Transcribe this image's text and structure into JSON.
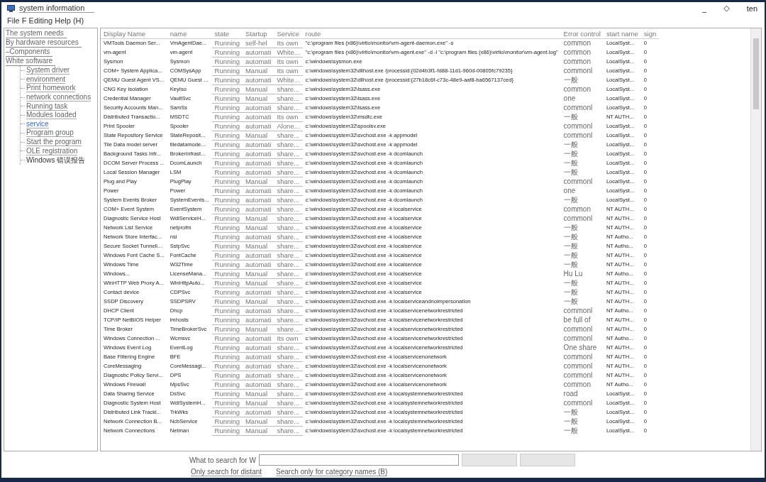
{
  "window": {
    "title": "system information",
    "controls": [
      "_",
      "◇",
      "ten"
    ]
  },
  "menu": "File F Editing Help (H)",
  "sidebar": {
    "items": [
      {
        "label": "The system needs",
        "selected": false
      },
      {
        "label": "By hardware resources",
        "selected": false
      },
      {
        "label": "–Components",
        "selected": false
      },
      {
        "label": "White software",
        "selected": false,
        "expanded": true,
        "children": [
          {
            "label": "System driver",
            "selected": false
          },
          {
            "label": "environment",
            "selected": false
          },
          {
            "label": "Print homework",
            "selected": false
          },
          {
            "label": "network connections",
            "selected": false
          },
          {
            "label": "Running task",
            "selected": false
          },
          {
            "label": "Modules loaded",
            "selected": false
          },
          {
            "label": "service",
            "selected": true
          },
          {
            "label": "Program group",
            "selected": false
          },
          {
            "label": "Start the program",
            "selected": false
          },
          {
            "label": "OLE registration",
            "selected": false
          },
          {
            "label": "Windows 错误报告",
            "selected": false
          }
        ]
      }
    ]
  },
  "table": {
    "columns": [
      "Display Name",
      "name",
      "state",
      "Startup",
      "Service",
      "route",
      "Error control",
      "start name",
      "sign"
    ],
    "rows": [
      {
        "cells": [
          "VMTools Daemon Ser...",
          "VmAgentDae...",
          "Running",
          "self-hel",
          "Its own",
          "\"c:\\program files (x86)\\virtio\\monitor\\vm-agent-daemon.exe\" -s",
          "common",
          "LocalSyst...",
          "0"
        ]
      },
      {
        "cells": [
          "vm-agent",
          "vm-agent",
          "Running",
          "automati",
          "White...",
          "\"c:\\program files (x86)\\virtio\\monitor\\vm-agent.exe\" -d -l \"c:\\program files (x86)\\virtio\\monitor\\vm-agent.log\"",
          "common",
          "LocalSyst...",
          "0"
        ]
      },
      {
        "cells": [
          "Sysmon",
          "Sysmon",
          "Running",
          "automati",
          "Its own",
          "c:\\windows\\sysmon.exe",
          "common",
          "LocalSyst...",
          "0"
        ]
      },
      {
        "cells": [
          "COM+ System Applica...",
          "COMSysApp",
          "Running",
          "Manual",
          "Its own",
          "c:\\windows\\system32\\dllhost.exe /processid:{02d4b3f1-fd88-11d1-960d-00805fc79235}",
          "commonl",
          "LocalSyst...",
          "0"
        ]
      },
      {
        "cells": [
          "QEMU Guest Agent VS...",
          "QEMU Guest ...",
          "Running",
          "automati",
          "White...",
          "c:\\windows\\system32\\dllhost.exe /processid:{27b18c6f-c73c-48e9-aaf8-ba6567137ced}",
          "一般",
          "LocalSyst...",
          "0"
        ]
      },
      {
        "cells": [
          "CNG Key Isolation",
          "KeyIso",
          "Running",
          "Manual",
          "share...",
          "c:\\windows\\system32\\lsass.exe",
          "common",
          "LocalSyst...",
          "0"
        ]
      },
      {
        "cells": [
          "Credential Manager",
          "VaultSvc",
          "Running",
          "Manual",
          "share...",
          "c:\\windows\\system32\\lsass.exe",
          "one",
          "LocalSyst...",
          "0"
        ]
      },
      {
        "cells": [
          "Security Accounts Man...",
          "SamSs",
          "Running",
          "automati",
          "share...",
          "c:\\windows\\system32\\lsass.exe",
          "commonl",
          "LocalSyst...",
          "0"
        ]
      },
      {
        "cells": [
          "Distributed Transactio...",
          "MSDTC",
          "Running",
          "automati",
          "Its own",
          "c:\\windows\\system32\\msdtc.exe",
          "一般",
          "NT AUTH...",
          "0"
        ]
      },
      {
        "cells": [
          "Print Spooler",
          "Spooler",
          "Running",
          "automati",
          "Alone...",
          "c:\\windows\\system32\\spoolsv.exe",
          "commonl",
          "LocalSyst...",
          "0"
        ]
      },
      {
        "cells": [
          "State Repository Service",
          "StateReposit...",
          "Running",
          "Manual",
          "share...",
          "c:\\windows\\system32\\svchost.exe -k appmodel",
          "commonl",
          "LocalSyst...",
          "0"
        ]
      },
      {
        "cells": [
          "Tile Data model server",
          "tiledatamode...",
          "Running",
          "automati",
          "share...",
          "c:\\windows\\system32\\svchost.exe -k appmodel",
          "一般",
          "LocalSyst...",
          "0"
        ]
      },
      {
        "cells": [
          "Background Tasks Infr...",
          "BrokerInfrast...",
          "Running",
          "automati",
          "share...",
          "c:\\windows\\system32\\svchost.exe -k dcomlaunch",
          "一般",
          "LocalSyst...",
          "0"
        ]
      },
      {
        "cells": [
          "DCOM Server Process ...",
          "DcomLaunch",
          "Running",
          "automati",
          "share...",
          "c:\\windows\\system32\\svchost.exe -k dcomlaunch",
          "一般",
          "LocalSyst...",
          "0"
        ]
      },
      {
        "cells": [
          "Local Session Manager",
          "LSM",
          "Running",
          "automati",
          "share...",
          "c:\\windows\\system32\\svchost.exe -k dcomlaunch",
          "一般",
          "LocalSyst...",
          "0"
        ]
      },
      {
        "cells": [
          "Plug and Play",
          "PlugPlay",
          "Running",
          "Manual",
          "share...",
          "c:\\windows\\system32\\svchost.exe -k dcomlaunch",
          "commonl",
          "LocalSyst...",
          "0"
        ]
      },
      {
        "cells": [
          "Power",
          "Power",
          "Running",
          "automati",
          "share...",
          "c:\\windows\\system32\\svchost.exe -k dcomlaunch",
          "one",
          "LocalSyst...",
          "0"
        ]
      },
      {
        "cells": [
          "System Events Broker",
          "SystemEvents...",
          "Running",
          "automati",
          "share...",
          "c:\\windows\\system32\\svchost.exe -k dcomlaunch",
          "一般",
          "LocalSyst...",
          "0"
        ]
      },
      {
        "cells": [
          "COM+ Event System",
          "EventSystem",
          "Running",
          "automati",
          "share...",
          "c:\\windows\\system32\\svchost.exe -k localservice",
          "common",
          "NT AUTH...",
          "0"
        ]
      },
      {
        "cells": [
          "Diagnostic Service Host",
          "WdiServiceH...",
          "Running",
          "Manual",
          "share...",
          "c:\\windows\\system32\\svchost.exe -k localservice",
          "commonl",
          "NT AUTH...",
          "0"
        ]
      },
      {
        "cells": [
          "Network List Service",
          "netprofm",
          "Running",
          "Manual",
          "share...",
          "c:\\windows\\system32\\svchost.exe -k localservice",
          "一般",
          "NT AUTH...",
          "0"
        ]
      },
      {
        "cells": [
          "Network Store Interfac...",
          "nsi",
          "Running",
          "automati",
          "share...",
          "c:\\windows\\system32\\svchost.exe -k localservice",
          "一般",
          "NT Autho...",
          "0"
        ]
      },
      {
        "cells": [
          "Secure Socket Tunneli...",
          "SstpSvc",
          "Running",
          "Manual",
          "share...",
          "c:\\windows\\system32\\svchost.exe -k localservice",
          "一般",
          "NT Autho...",
          "0"
        ]
      },
      {
        "cells": [
          "Windows Font Cache S...",
          "FontCache",
          "Running",
          "automati",
          "share...",
          "c:\\windows\\system32\\svchost.exe -k localservice",
          "一般",
          "NT AUTH...",
          "0"
        ]
      },
      {
        "cells": [
          "Windows Time",
          "W32Time",
          "Running",
          "automati",
          "share...",
          "c:\\windows\\system32\\svchost.exe -k localservice",
          "一般",
          "NT AUTH...",
          "0"
        ]
      },
      {
        "cells": [
          "Windows...",
          "LicenseMana...",
          "Running",
          "Manual",
          "share...",
          "c:\\windows\\system32\\svchost.exe -k localservice",
          "Hu Lu",
          "NT Autho...",
          "0"
        ]
      },
      {
        "cells": [
          "WinHTTP Web Proxy A...",
          "WinHttpAuto...",
          "Running",
          "Manual",
          "share...",
          "c:\\windows\\system32\\svchost.exe -k localservice",
          "一般",
          "NT AUTH...",
          "0"
        ]
      },
      {
        "cells": [
          "Contact device",
          "CDPSvc",
          "Running",
          "automati",
          "share...",
          "c:\\windows\\system32\\svchost.exe -k localservice",
          "一般",
          "NT AUTH...",
          "0"
        ]
      },
      {
        "cells": [
          "SSDP Discovery",
          "SSDPSRV",
          "Running",
          "Manual",
          "share...",
          "c:\\windows\\system32\\svchost.exe -k localserviceandnoimpersonation",
          "一般",
          "NT AUTH...",
          "0"
        ]
      },
      {
        "cells": [
          "DHCP Client",
          "Dhcp",
          "Running",
          "automati",
          "share...",
          "c:\\windows\\system32\\svchost.exe -k localservicenetworkrestricted",
          "commonl",
          "NT Autho...",
          "0"
        ]
      },
      {
        "cells": [
          "TCP/IP NetBIOS Helper",
          "lmhosts",
          "Running",
          "automati",
          "share...",
          "c:\\windows\\system32\\svchost.exe -k localservicenetworkrestricted",
          "be full of",
          "NT AUTH...",
          "0"
        ]
      },
      {
        "cells": [
          "Time Broker",
          "TimeBrokerSvc",
          "Running",
          "Manual",
          "share...",
          "c:\\windows\\system32\\svchost.exe -k localservicenetworkrestricted",
          "commonl",
          "NT AUTH...",
          "0"
        ]
      },
      {
        "cells": [
          "Windows Connection ...",
          "Wcmsvc",
          "Running",
          "automati",
          "Its own",
          "c:\\windows\\system32\\svchost.exe -k localservicenetworkrestricted",
          "commonl",
          "NT Autho...",
          "0"
        ]
      },
      {
        "cells": [
          "Windows Event Log",
          "EventLog",
          "Running",
          "automati",
          "share...",
          "c:\\windows\\system32\\svchost.exe -k localservicenetworkrestricted",
          "One share",
          "NT AUTH...",
          "0"
        ]
      },
      {
        "cells": [
          "Base Filtering Engine",
          "BFE",
          "Running",
          "automati",
          "share...",
          "c:\\windows\\system32\\svchost.exe -k localservicenonetwork",
          "commonl",
          "NT AUTH...",
          "0"
        ]
      },
      {
        "cells": [
          "CoreMessaging",
          "CoreMessagi...",
          "Running",
          "automati",
          "share...",
          "c:\\windows\\system32\\svchost.exe -k localservicenonetwork",
          "commonl",
          "NT AUTH...",
          "0"
        ]
      },
      {
        "cells": [
          "Diagnostic Policy Servi...",
          "DPS",
          "Running",
          "automati",
          "share...",
          "c:\\windows\\system32\\svchost.exe -k localservicenonetwork",
          "commonl",
          "NT AUTH...",
          "0"
        ]
      },
      {
        "cells": [
          "Windows Firewall",
          "MpsSvc",
          "Running",
          "automati",
          "share...",
          "c:\\windows\\system32\\svchost.exe -k localservicenonetwork",
          "common",
          "NT Autho...",
          "0"
        ]
      },
      {
        "cells": [
          "Data Sharing Service",
          "DsSvc",
          "Running",
          "Manual",
          "share...",
          "c:\\windows\\system32\\svchost.exe -k localsystemnetworkrestricted",
          "road",
          "LocalSyst...",
          "0"
        ]
      },
      {
        "cells": [
          "Diagnostic System Host",
          "WdiSystemH...",
          "Running",
          "Manual",
          "share...",
          "c:\\windows\\system32\\svchost.exe -k localsystemnetworkrestricted",
          "commonl",
          "LocalSyst...",
          "0"
        ]
      },
      {
        "cells": [
          "Distributed Link Tracki...",
          "TrkWks",
          "Running",
          "automati",
          "share...",
          "c:\\windows\\system32\\svchost.exe -k localsystemnetworkrestricted",
          "一般",
          "LocalSyst...",
          "0"
        ]
      },
      {
        "cells": [
          "Network Connection B...",
          "NcbService",
          "Running",
          "Manual",
          "share...",
          "c:\\windows\\system32\\svchost.exe -k localsystemnetworkrestricted",
          "一般",
          "LocalSyst...",
          "0"
        ]
      },
      {
        "cells": [
          "Network Connections",
          "Netman",
          "Running",
          "Manual",
          "share...",
          "c:\\windows\\system32\\svchost.exe -k localsystemnetworkrestricted",
          "一般",
          "LocalSyst...",
          "0"
        ]
      }
    ]
  },
  "search": {
    "label": "What to search for W",
    "buttons": [
      {
        "disabled": true
      },
      {
        "disabled": true
      }
    ],
    "options": [
      "Only search for distant",
      "Search only for category names (B)"
    ]
  }
}
